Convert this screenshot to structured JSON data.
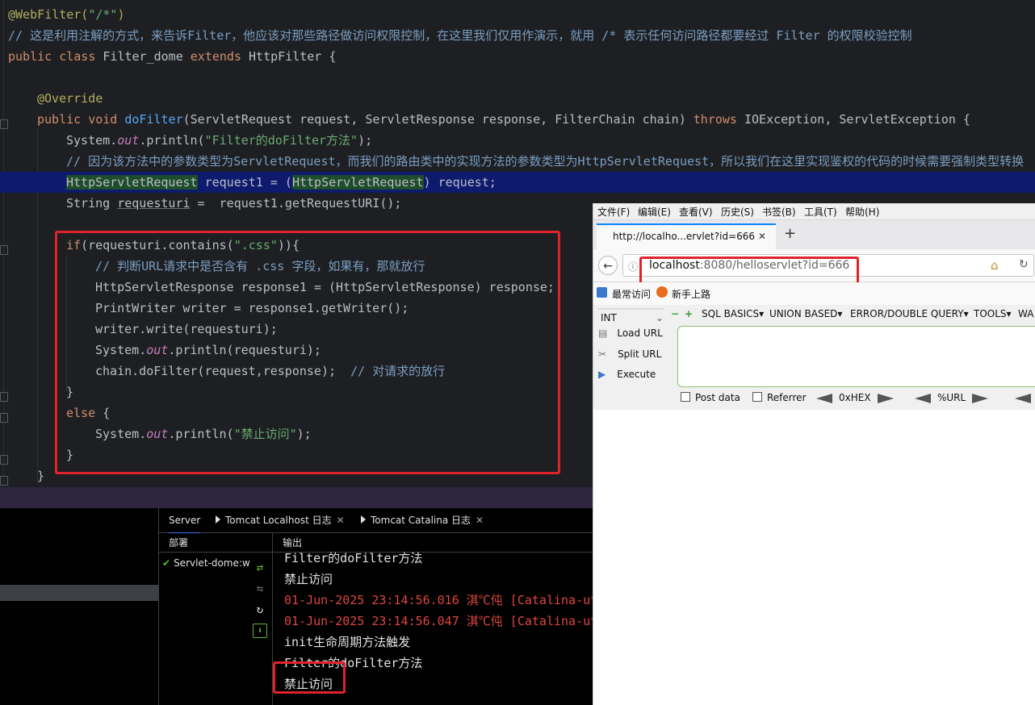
{
  "code": {
    "l1_ann": "@WebFilter(",
    "l1_str": "\"/*\"",
    "l1_end": ")",
    "l2_cmt": "// 这是利用注解的方式，来告诉Filter，他应该对那些路径做访问权限控制，在这里我们仅用作演示，就用 /* 表示任何访问路径都要经过 Filter 的权限校验控制",
    "l3_kw1": "public class ",
    "l3_name": "Filter_dome ",
    "l3_kw2": "extends ",
    "l3_rest": "HttpFilter {",
    "l5_ann": "@Override",
    "l6_kw": "public void ",
    "l6_fn": "doFilter",
    "l6_args": "(ServletRequest request, ServletResponse response, FilterChain chain) ",
    "l6_throws": "throws ",
    "l6_rest": "IOException, ServletException {",
    "l7_a": "System.",
    "l7_out": "out",
    "l7_b": ".println(",
    "l7_str": "\"Filter的doFilter方法\"",
    "l7_c": ");",
    "l8_cmt": "// 因为该方法中的参数类型为ServletRequest，而我们的路由类中的实现方法的参数类型为HttpServletRequest，所以我们在这里实现鉴权的代码的时候需要强制类型转换",
    "l9_a": "HttpServletRequest",
    "l9_b": " request1 = (",
    "l9_c": "HttpServletRequest",
    "l9_d": ") request;",
    "l10_a": "String ",
    "l10_var": "requesturi",
    "l10_b": " =  request1.getRequestURI();",
    "l12_kw": "if",
    "l12_a": "(requesturi.contains(",
    "l12_str": "\".css\"",
    "l12_b": ")){",
    "l13_cmt": "// 判断URL请求中是否含有 .css 字段，如果有，那就放行",
    "l14": "HttpServletResponse response1 = (HttpServletResponse) response;",
    "l15": "PrintWriter writer = response1.getWriter();",
    "l16": "writer.write(requesturi);",
    "l17_a": "System.",
    "l17_out": "out",
    "l17_b": ".println(requesturi);",
    "l18_a": "chain.doFilter(request,response);  ",
    "l18_cmt": "// 对请求的放行",
    "l19": "}",
    "l20_kw": "else",
    "l20_b": " {",
    "l21_a": "System.",
    "l21_out": "out",
    "l21_b": ".println(",
    "l21_str": "\"禁止访问\"",
    "l21_c": ");",
    "l22": "}",
    "l23": "}"
  },
  "run_panel": {
    "tabs": [
      {
        "label": "Server"
      },
      {
        "label": "Tomcat Localhost 日志"
      },
      {
        "label": "Tomcat Catalina 日志"
      }
    ],
    "close_glyph": "✕",
    "deploy_header": "部署",
    "output_header": "输出",
    "deploy_item": "Servlet-dome:w",
    "output_lines": [
      {
        "text": "Filter的doFilter方法",
        "red": false
      },
      {
        "text": "禁止访问",
        "red": false
      },
      {
        "text": "01-Jun-2025 23:14:56.016 淇℃伅 [Catalina-ut",
        "red": true
      },
      {
        "text": "01-Jun-2025 23:14:56.047 淇℃伅 [Catalina-ut",
        "red": true
      },
      {
        "text": "init生命周期方法触发",
        "red": false
      },
      {
        "text": "Filter的doFilter方法",
        "red": false
      },
      {
        "text": "禁止访问",
        "red": false
      }
    ]
  },
  "browser": {
    "menu": [
      "文件(F)",
      "编辑(E)",
      "查看(V)",
      "历史(S)",
      "书签(B)",
      "工具(T)",
      "帮助(H)"
    ],
    "tab_title": "http://localho...ervlet?id=666",
    "tab_close": "✕",
    "new_tab": "+",
    "url_host": "localhost",
    "url_rest": ":8080/helloservlet?id=666",
    "bookmarks": [
      "最常访问",
      "新手上路"
    ],
    "hackbar": {
      "select_value": "INT",
      "menus": [
        "SQL BASICS▾",
        "UNION BASED▾",
        "ERROR/DOUBLE QUERY▾",
        "TOOLS▾",
        "WA"
      ],
      "load_url": "Load URL",
      "split_url": "Split URL",
      "execute": "Execute",
      "post_data": "Post data",
      "referrer": "Referrer",
      "hex": "0xHEX",
      "url_enc": "%URL"
    }
  },
  "colors": {
    "accent": "#3574f0",
    "highlight_red": "#e0222b",
    "selection_line": "#0d1a6e"
  }
}
